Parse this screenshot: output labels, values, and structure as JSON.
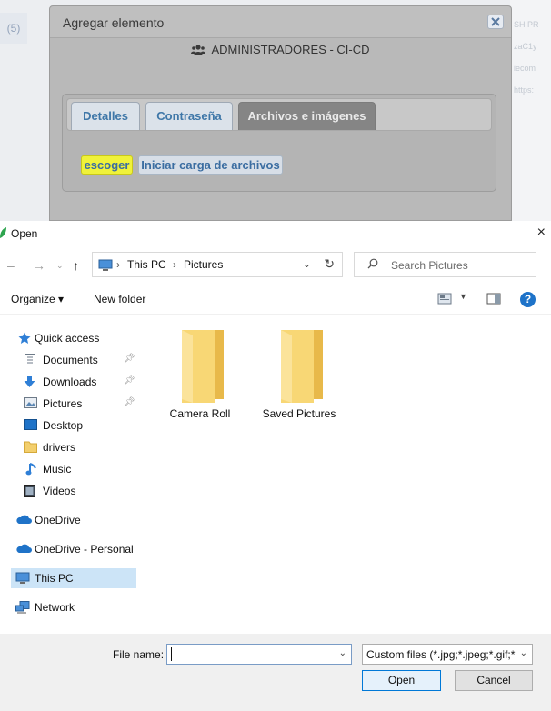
{
  "webpage": {
    "left_number": "(5)",
    "right_snippets": [
      "SH PR",
      "zaC1y",
      "iecom",
      "https:"
    ]
  },
  "modal": {
    "title": "Agregar elemento",
    "close_icon": "close-icon",
    "group_icon": "users-icon",
    "group_name": "ADMINISTRADORES - CI-CD",
    "tabs": [
      {
        "label": "Detalles",
        "active": false
      },
      {
        "label": "Contraseña",
        "active": false
      },
      {
        "label": "Archivos e imágenes",
        "active": true
      }
    ],
    "choose_label": "escoger",
    "start_upload_label": "Iniciar carga de archivos"
  },
  "dialog": {
    "title": "Open",
    "close_glyph": "×",
    "breadcrumb": [
      "This PC",
      "Pictures"
    ],
    "search_placeholder": "Search Pictures",
    "toolbar": {
      "organize": "Organize ▾",
      "new_folder": "New folder"
    },
    "nav_items": [
      {
        "label": "Quick access",
        "icon": "star-icon"
      },
      {
        "label": "Documents",
        "icon": "document-icon",
        "pinned": true
      },
      {
        "label": "Downloads",
        "icon": "download-icon",
        "pinned": true
      },
      {
        "label": "Pictures",
        "icon": "pictures-icon",
        "pinned": true
      },
      {
        "label": "Desktop",
        "icon": "desktop-icon"
      },
      {
        "label": "drivers",
        "icon": "folder-icon"
      },
      {
        "label": "Music",
        "icon": "music-icon"
      },
      {
        "label": "Videos",
        "icon": "video-icon"
      },
      {
        "label": "OneDrive",
        "icon": "cloud-icon"
      },
      {
        "label": "OneDrive - Personal",
        "icon": "cloud-icon"
      },
      {
        "label": "This PC",
        "icon": "computer-icon",
        "selected": true
      },
      {
        "label": "Network",
        "icon": "network-icon"
      }
    ],
    "folders": [
      "Camera Roll",
      "Saved Pictures"
    ],
    "file_name_label": "File name:",
    "file_name_value": "",
    "file_type_filter": "Custom files (*.jpg;*.jpeg;*.gif;*",
    "open_label": "Open",
    "cancel_label": "Cancel"
  }
}
